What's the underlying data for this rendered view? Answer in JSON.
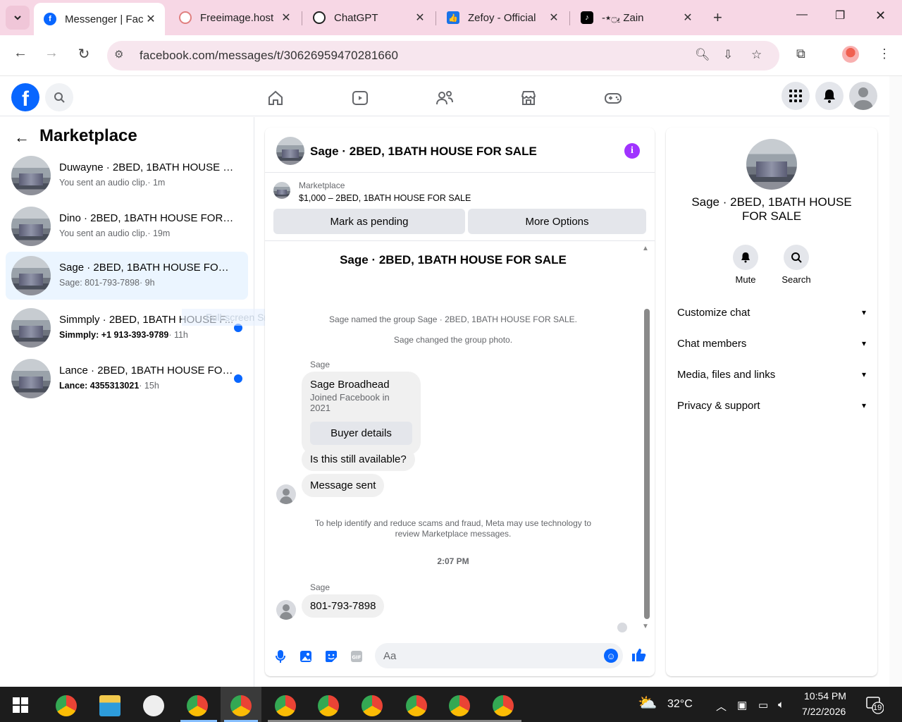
{
  "browser": {
    "tabs": [
      {
        "title": "Messenger | Fac",
        "favicon": "facebook-icon",
        "color": "#0866ff",
        "active": true
      },
      {
        "title": "Freeimage.host",
        "favicon": "freeimage-icon",
        "color": "#e08080"
      },
      {
        "title": "ChatGPT",
        "favicon": "chatgpt-icon",
        "color": "#222222"
      },
      {
        "title": "Zefoy - Official",
        "favicon": "thumbs-up-icon",
        "color": "#1a73e8"
      },
      {
        "title": "-ﯾ۝٭ Zain",
        "favicon": "tiktok-icon",
        "color": "#000000"
      }
    ],
    "url": "facebook.com/messages/t/30626959470281660"
  },
  "sidebar": {
    "title": "Marketplace",
    "conversations": [
      {
        "name": "Duwayne · 2BED, 1BATH HOUSE F...",
        "preview": "You sent an audio clip.",
        "time": "· 1m",
        "unread": false
      },
      {
        "name": "Dino · 2BED, 1BATH HOUSE FOR S...",
        "preview": "You sent an audio clip.",
        "time": "· 19m",
        "unread": false
      },
      {
        "name": "Sage · 2BED, 1BATH HOUSE FOR S...",
        "preview": "Sage: 801-793-7898",
        "time": "· 9h",
        "unread": false,
        "selected": true
      },
      {
        "name": "Simmply · 2BED, 1BATH HOUSE F...",
        "preview": "Simmply: +1 913-393-9789",
        "time": "· 11h",
        "unread": true
      },
      {
        "name": "Lance · 2BED, 1BATH HOUSE FOR...",
        "preview": "Lance: 4355313021",
        "time": "· 15h",
        "unread": true
      }
    ],
    "ghost_text": "Full-screen Snip"
  },
  "chat": {
    "title": "Sage · 2BED, 1BATH HOUSE FOR SALE",
    "marketplace_label": "Marketplace",
    "listing": "$1,000 – 2BED, 1BATH HOUSE FOR SALE",
    "mark_pending": "Mark as pending",
    "more_options": "More Options",
    "group_title": "Sage · 2BED, 1BATH HOUSE FOR SALE",
    "sys1": "Sage named the group Sage · 2BED, 1BATH HOUSE FOR SALE.",
    "sys2": "Sage changed the group photo.",
    "sender1": "Sage",
    "card_name": "Sage Broadhead",
    "card_sub": "Joined Facebook in 2021",
    "card_btn": "Buyer details",
    "msg1": "Is this still available?",
    "msg2": "Message sent",
    "notice": "To help identify and reduce scams and fraud, Meta may use technology to review Marketplace messages.",
    "timestamp": "2:07 PM",
    "sender2": "Sage",
    "msg3": "801-793-7898",
    "composer_placeholder": "Aa"
  },
  "info_panel": {
    "name": "Sage · 2BED, 1BATH HOUSE FOR SALE",
    "mute": "Mute",
    "search": "Search",
    "rows": [
      "Customize chat",
      "Chat members",
      "Media, files and links",
      "Privacy & support"
    ]
  },
  "taskbar": {
    "weather": "32°C",
    "time": "10:54 PM",
    "date": "7/22/2026",
    "notifications": "19"
  }
}
